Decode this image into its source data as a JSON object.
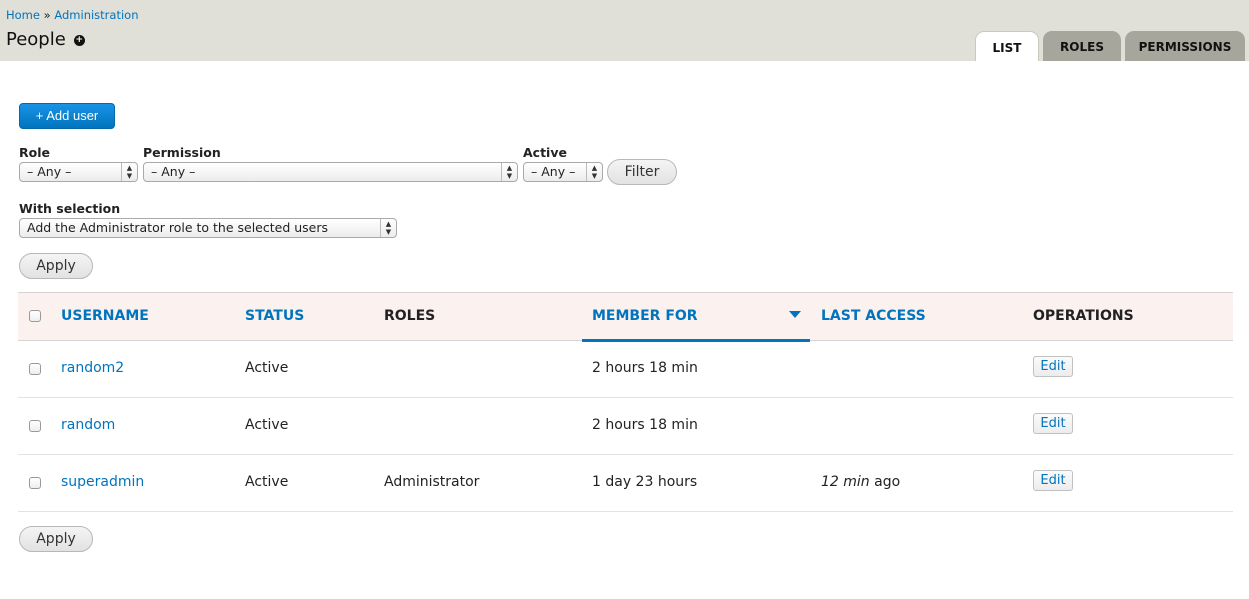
{
  "breadcrumb": {
    "home": "Home",
    "separator": "»",
    "current": "Administration"
  },
  "page": {
    "title": "People",
    "shortcut_icon": "plus-circle-icon"
  },
  "tabs": [
    {
      "label": "LIST",
      "active": true
    },
    {
      "label": "ROLES",
      "active": false
    },
    {
      "label": "PERMISSIONS",
      "active": false
    }
  ],
  "add_user_button": "+ Add user",
  "filters": {
    "role": {
      "label": "Role",
      "value": "– Any –"
    },
    "permission": {
      "label": "Permission",
      "value": "– Any –"
    },
    "active": {
      "label": "Active",
      "value": "– Any –"
    },
    "filter_button": "Filter"
  },
  "bulk": {
    "label": "With selection",
    "value": "Add the Administrator role to the selected users",
    "apply_button": "Apply"
  },
  "table": {
    "headers": {
      "username": "USERNAME",
      "status": "STATUS",
      "roles": "ROLES",
      "member_for": "MEMBER FOR",
      "last_access": "LAST ACCESS",
      "operations": "OPERATIONS"
    },
    "rows": [
      {
        "username": "random2",
        "status": "Active",
        "roles": "",
        "member_for": "2 hours 18 min",
        "last_access_em": "",
        "last_access_suffix": "",
        "operation": "Edit"
      },
      {
        "username": "random",
        "status": "Active",
        "roles": "",
        "member_for": "2 hours 18 min",
        "last_access_em": "",
        "last_access_suffix": "",
        "operation": "Edit"
      },
      {
        "username": "superadmin",
        "status": "Active",
        "roles": "Administrator",
        "member_for": "1 day 23 hours",
        "last_access_em": "12 min",
        "last_access_suffix": " ago",
        "operation": "Edit"
      }
    ]
  },
  "bottom_apply_button": "Apply",
  "colors": {
    "link": "#0074bd",
    "header_bg": "#e0e0d8",
    "table_head_bg": "#fbf2ef"
  }
}
